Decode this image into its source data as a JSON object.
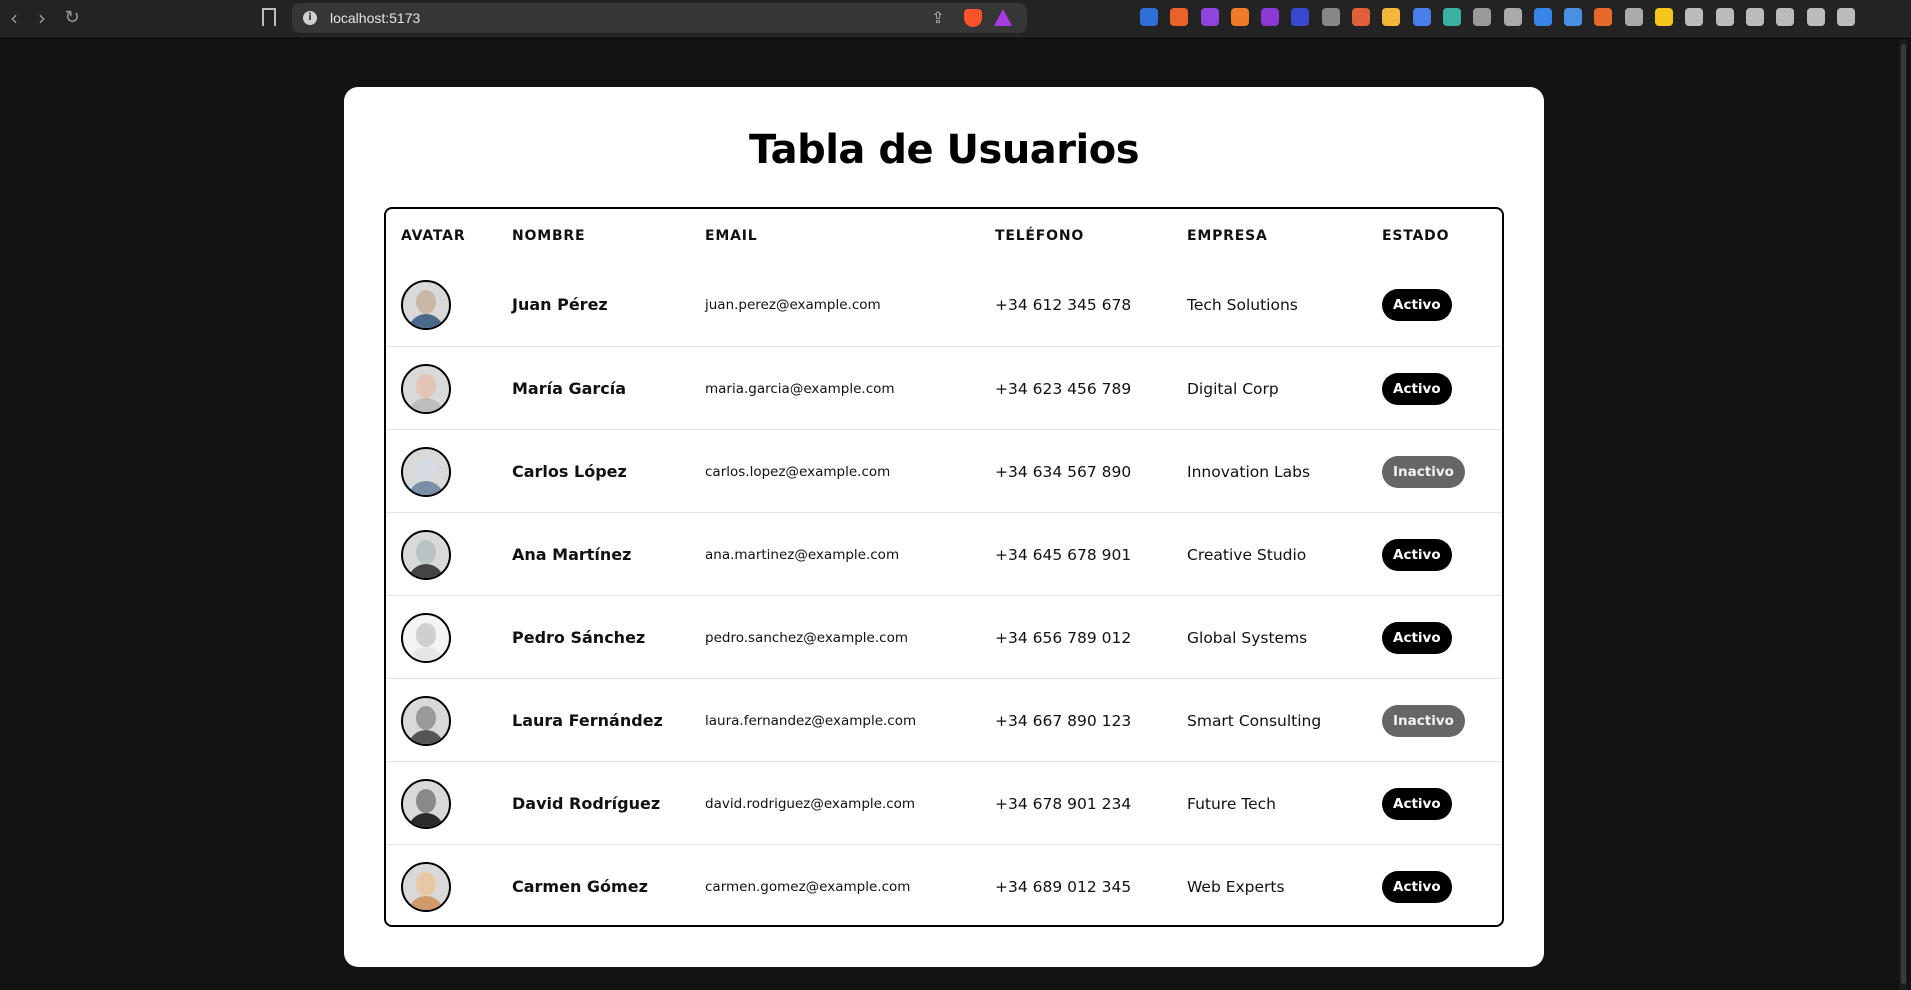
{
  "browser": {
    "url": "localhost:5173",
    "back_icon": "chevron-left-icon",
    "forward_icon": "chevron-right-icon",
    "reload_icon": "reload-icon",
    "extension_badge": "5",
    "extension_colors": [
      "#2f6fd6",
      "#e8622a",
      "#8e44dd",
      "#f07a2a",
      "#8a39d4",
      "#3a4ad0",
      "#888888",
      "#e0603a",
      "#f5b73a",
      "#4a7ee8",
      "#3ab0a0",
      "#9a9a9a",
      "#aaaaaa",
      "#3a85e8",
      "#4a90e2",
      "#e86a2a",
      "#aaaaaa",
      "#f5c518",
      "#bbbbbb",
      "#bbbbbb",
      "#bbbbbb",
      "#bbbbbb",
      "#bbbbbb",
      "#bbbbbb"
    ]
  },
  "page": {
    "title": "Tabla de Usuarios"
  },
  "table": {
    "headers": {
      "avatar": "AVATAR",
      "name": "NOMBRE",
      "email": "EMAIL",
      "phone": "TELÉFONO",
      "company": "EMPRESA",
      "status": "ESTADO"
    },
    "rows": [
      {
        "name": "Juan Pérez",
        "email": "juan.perez@example.com",
        "phone": "+34 612 345 678",
        "company": "Tech Solutions",
        "status": "Activo",
        "active": true,
        "avatar_face": "#c9b8a6",
        "avatar_body": "#4b6a8a"
      },
      {
        "name": "María García",
        "email": "maria.garcia@example.com",
        "phone": "+34 623 456 789",
        "company": "Digital Corp",
        "status": "Activo",
        "active": true,
        "avatar_face": "#e3c5b5",
        "avatar_body": "#bdbdbd"
      },
      {
        "name": "Carlos López",
        "email": "carlos.lopez@example.com",
        "phone": "+34 634 567 890",
        "company": "Innovation Labs",
        "status": "Inactivo",
        "active": false,
        "avatar_face": "#d6dbe3",
        "avatar_body": "#7b8ea8"
      },
      {
        "name": "Ana Martínez",
        "email": "ana.martinez@example.com",
        "phone": "+34 645 678 901",
        "company": "Creative Studio",
        "status": "Activo",
        "active": true,
        "avatar_face": "#b9c4c4",
        "avatar_body": "#444444"
      },
      {
        "name": "Pedro Sánchez",
        "email": "pedro.sanchez@example.com",
        "phone": "+34 656 789 012",
        "company": "Global Systems",
        "status": "Activo",
        "active": true,
        "avatar_face": "#cfcfcf",
        "avatar_body": "#e6e6e6"
      },
      {
        "name": "Laura Fernández",
        "email": "laura.fernandez@example.com",
        "phone": "+34 667 890 123",
        "company": "Smart Consulting",
        "status": "Inactivo",
        "active": false,
        "avatar_face": "#9a9a9a",
        "avatar_body": "#555555"
      },
      {
        "name": "David Rodríguez",
        "email": "david.rodriguez@example.com",
        "phone": "+34 678 901 234",
        "company": "Future Tech",
        "status": "Activo",
        "active": true,
        "avatar_face": "#8a8a8a",
        "avatar_body": "#2a2a2a"
      },
      {
        "name": "Carmen Gómez",
        "email": "carmen.gomez@example.com",
        "phone": "+34 689 012 345",
        "company": "Web Experts",
        "status": "Activo",
        "active": true,
        "avatar_face": "#e8c9a6",
        "avatar_body": "#d19a6a"
      }
    ]
  },
  "colors": {
    "active_badge": "#000000",
    "inactive_badge": "#666666",
    "card_bg": "#ffffff",
    "page_bg": "#121212"
  }
}
